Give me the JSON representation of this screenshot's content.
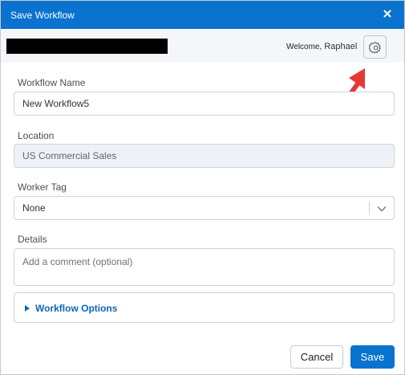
{
  "dialog": {
    "title": "Save Workflow",
    "close_icon": "close-icon"
  },
  "userbar": {
    "welcome_label": "Welcome,",
    "user_name": "Raphael",
    "settings_icon": "gear-icon"
  },
  "form": {
    "workflow_name": {
      "label": "Workflow Name",
      "value": "New Workflow5"
    },
    "location": {
      "label": "Location",
      "value": "US Commercial Sales"
    },
    "worker_tag": {
      "label": "Worker Tag",
      "value": "None"
    },
    "details": {
      "label": "Details",
      "placeholder": "Add a comment (optional)"
    },
    "workflow_options": {
      "label": "Workflow Options"
    }
  },
  "footer": {
    "cancel_label": "Cancel",
    "save_label": "Save"
  },
  "colors": {
    "accent": "#0a72cf",
    "annotation_arrow": "#e53935"
  }
}
